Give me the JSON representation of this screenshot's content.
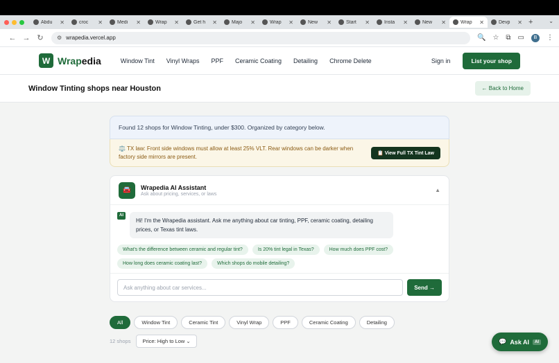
{
  "browser": {
    "tabs": [
      {
        "label": "Abdu",
        "icon": "github-icon"
      },
      {
        "label": "croc",
        "icon": "github-icon"
      },
      {
        "label": "Medi",
        "icon": "globe-icon"
      },
      {
        "label": "Wrap",
        "icon": "globe-icon"
      },
      {
        "label": "Get h",
        "icon": "doc-icon"
      },
      {
        "label": "Majo",
        "icon": "shield-icon"
      },
      {
        "label": "Wrap",
        "icon": "wrapedia-icon"
      },
      {
        "label": "New",
        "icon": "globe-icon"
      },
      {
        "label": "Start",
        "icon": "diamond-icon"
      },
      {
        "label": "Insta",
        "icon": "github-icon"
      },
      {
        "label": "New",
        "icon": "triangle-icon"
      },
      {
        "label": "Wrap",
        "icon": "wrapedia-icon",
        "active": true
      },
      {
        "label": "Devp",
        "icon": "globe-icon"
      }
    ],
    "url": "wrapedia.vercel.app",
    "profile_initial": "B"
  },
  "header": {
    "logo_letter": "W",
    "logo_text_green": "Wrap",
    "logo_text_dark": "edia",
    "nav": [
      "Window Tint",
      "Vinyl Wraps",
      "PPF",
      "Ceramic Coating",
      "Detailing",
      "Chrome Delete"
    ],
    "signin": "Sign in",
    "cta": "List your shop"
  },
  "titlebar": {
    "title": "Window Tinting shops near Houston",
    "back": "← Back to Home"
  },
  "results": {
    "found": "Found 12 shops for Window Tinting, under $300. Organized by category below.",
    "law_text": "⚖️ TX law: Front side windows must allow at least 25% VLT. Rear windows can be darker when factory side mirrors are present.",
    "law_button": "📋 View Full TX Tint Law"
  },
  "assistant": {
    "title": "Wrapedia AI Assistant",
    "subtitle": "Ask about pricing, services, or laws",
    "ai_tag": "AI",
    "message": "Hi! I'm the Wrapedia assistant. Ask me anything about car tinting, PPF, ceramic coating, detailing prices, or Texas tint laws.",
    "chips": [
      "What's the difference between ceramic and regular tint?",
      "Is 20% tint legal in Texas?",
      "How much does PPF cost?",
      "How long does ceramic coating last?",
      "Which shops do mobile detailing?"
    ],
    "input_placeholder": "Ask anything about car services...",
    "send": "Send →"
  },
  "filters": {
    "pills": [
      "All",
      "Window Tint",
      "Ceramic Tint",
      "Vinyl Wrap",
      "PPF",
      "Ceramic Coating",
      "Detailing"
    ],
    "active": "All",
    "count": "12 shops",
    "sort": "Price: High to Low"
  },
  "floating": {
    "label": "Ask AI",
    "badge": "AI"
  },
  "colors": {
    "brand_green": "#1f6b3a",
    "law_bg": "#fbf6e7",
    "found_bg": "#eef3fb"
  }
}
